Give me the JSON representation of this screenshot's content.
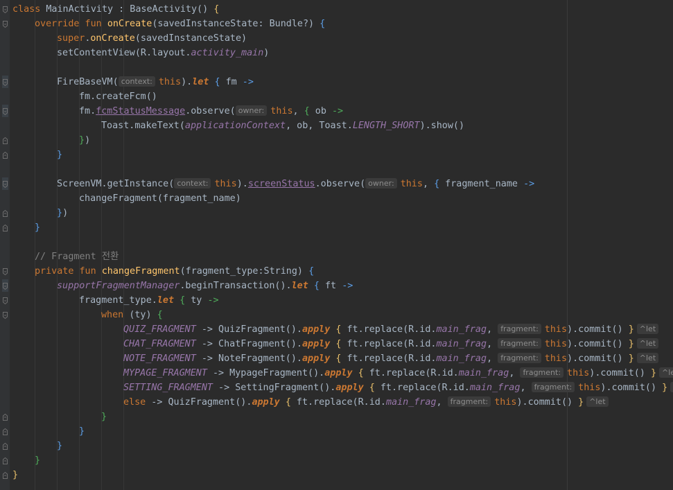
{
  "editor": {
    "language": "Kotlin",
    "lines": [
      [
        [
          "kw",
          "class "
        ],
        [
          "t",
          "MainActivity : BaseActivity() "
        ],
        [
          "by",
          "{"
        ]
      ],
      [
        [
          "kw",
          "override fun "
        ],
        [
          "fn",
          "onCreate"
        ],
        [
          "t",
          "(savedInstanceState: Bundle?) "
        ],
        [
          "bb",
          "{"
        ]
      ],
      [
        [
          "kw",
          "super"
        ],
        [
          "t",
          "."
        ],
        [
          "fn",
          "onCreate"
        ],
        [
          "t",
          "(savedInstanceState)"
        ]
      ],
      [
        [
          "t",
          "setContentView(R.layout."
        ],
        [
          "prop",
          "activity_main"
        ],
        [
          "t",
          ")"
        ]
      ],
      [],
      [
        [
          "t",
          "FireBaseVM("
        ],
        [
          "hint",
          "context:"
        ],
        [
          "this",
          "this"
        ],
        [
          "t",
          ")."
        ],
        [
          "lkw",
          "let"
        ],
        [
          "t",
          " "
        ],
        [
          "bb",
          "{"
        ],
        [
          "t",
          " fm "
        ],
        [
          "bb",
          "->"
        ]
      ],
      [
        [
          "t",
          "fm.createFcm()"
        ]
      ],
      [
        [
          "t",
          "fm."
        ],
        [
          "link",
          "fcmStatusMessage"
        ],
        [
          "t",
          ".observe("
        ],
        [
          "hint",
          "owner:"
        ],
        [
          "this",
          "this"
        ],
        [
          "t",
          ", "
        ],
        [
          "bg",
          "{"
        ],
        [
          "t",
          " ob "
        ],
        [
          "bg",
          "->"
        ]
      ],
      [
        [
          "t",
          "Toast.makeText("
        ],
        [
          "prop",
          "applicationContext"
        ],
        [
          "t",
          ", ob, Toast."
        ],
        [
          "prop",
          "LENGTH_SHORT"
        ],
        [
          "t",
          ").show()"
        ]
      ],
      [
        [
          "bg",
          "}"
        ],
        [
          "t",
          ")"
        ]
      ],
      [
        [
          "bb",
          "}"
        ]
      ],
      [],
      [
        [
          "t",
          "ScreenVM.getInstance("
        ],
        [
          "hint",
          "context:"
        ],
        [
          "this",
          "this"
        ],
        [
          "t",
          ")."
        ],
        [
          "link",
          "screenStatus"
        ],
        [
          "t",
          ".observe("
        ],
        [
          "hint",
          "owner:"
        ],
        [
          "this",
          "this"
        ],
        [
          "t",
          ", "
        ],
        [
          "bb",
          "{"
        ],
        [
          "t",
          " fragment_name "
        ],
        [
          "bb",
          "->"
        ]
      ],
      [
        [
          "t",
          "changeFragment(fragment_name)"
        ]
      ],
      [
        [
          "bb",
          "}"
        ],
        [
          "t",
          ")"
        ]
      ],
      [
        [
          "bb",
          "}"
        ]
      ],
      [],
      [
        [
          "c",
          "// Fragment 전환"
        ]
      ],
      [
        [
          "kw",
          "private fun "
        ],
        [
          "fn",
          "changeFragment"
        ],
        [
          "t",
          "(fragment_type:String) "
        ],
        [
          "bb",
          "{"
        ]
      ],
      [
        [
          "prop",
          "supportFragmentManager"
        ],
        [
          "t",
          ".beginTransaction()."
        ],
        [
          "lkw",
          "let"
        ],
        [
          "t",
          " "
        ],
        [
          "bb",
          "{"
        ],
        [
          "t",
          " ft "
        ],
        [
          "bb",
          "->"
        ]
      ],
      [
        [
          "t",
          "fragment_type."
        ],
        [
          "lkw",
          "let"
        ],
        [
          "t",
          " "
        ],
        [
          "bg",
          "{"
        ],
        [
          "t",
          " ty "
        ],
        [
          "bg",
          "->"
        ]
      ],
      [
        [
          "kw",
          "when "
        ],
        [
          "t",
          "(ty) "
        ],
        [
          "bg",
          "{"
        ]
      ],
      [
        [
          "prop",
          "QUIZ_FRAGMENT"
        ],
        [
          "t",
          " -> QuizFragment()."
        ],
        [
          "lkw",
          "apply"
        ],
        [
          "t",
          " "
        ],
        [
          "by",
          "{"
        ],
        [
          "t",
          " ft.replace(R.id."
        ],
        [
          "prop",
          "main_frag"
        ],
        [
          "t",
          ", "
        ],
        [
          "hint",
          "fragment:"
        ],
        [
          "this",
          "this"
        ],
        [
          "t",
          ").commit() "
        ],
        [
          "by",
          "}"
        ],
        [
          "hintlet",
          "^let"
        ]
      ],
      [
        [
          "prop",
          "CHAT_FRAGMENT"
        ],
        [
          "t",
          " -> ChatFragment()."
        ],
        [
          "lkw",
          "apply"
        ],
        [
          "t",
          " "
        ],
        [
          "by",
          "{"
        ],
        [
          "t",
          " ft.replace(R.id."
        ],
        [
          "prop",
          "main_frag"
        ],
        [
          "t",
          ", "
        ],
        [
          "hint",
          "fragment:"
        ],
        [
          "this",
          "this"
        ],
        [
          "t",
          ").commit() "
        ],
        [
          "by",
          "}"
        ],
        [
          "hintlet",
          "^let"
        ]
      ],
      [
        [
          "prop",
          "NOTE_FRAGMENT"
        ],
        [
          "t",
          " -> NoteFragment()."
        ],
        [
          "lkw",
          "apply"
        ],
        [
          "t",
          " "
        ],
        [
          "by",
          "{"
        ],
        [
          "t",
          " ft.replace(R.id."
        ],
        [
          "prop",
          "main_frag"
        ],
        [
          "t",
          ", "
        ],
        [
          "hint",
          "fragment:"
        ],
        [
          "this",
          "this"
        ],
        [
          "t",
          ").commit() "
        ],
        [
          "by",
          "}"
        ],
        [
          "hintlet",
          "^let"
        ]
      ],
      [
        [
          "prop",
          "MYPAGE_FRAGMENT"
        ],
        [
          "t",
          " -> MypageFragment()."
        ],
        [
          "lkw",
          "apply"
        ],
        [
          "t",
          " "
        ],
        [
          "by",
          "{"
        ],
        [
          "t",
          " ft.replace(R.id."
        ],
        [
          "prop",
          "main_frag"
        ],
        [
          "t",
          ", "
        ],
        [
          "hint",
          "fragment:"
        ],
        [
          "this",
          "this"
        ],
        [
          "t",
          ").commit() "
        ],
        [
          "by",
          "}"
        ],
        [
          "hintlet",
          "^let"
        ]
      ],
      [
        [
          "prop",
          "SETTING_FRAGMENT"
        ],
        [
          "t",
          " -> SettingFragment()."
        ],
        [
          "lkw",
          "apply"
        ],
        [
          "t",
          " "
        ],
        [
          "by",
          "{"
        ],
        [
          "t",
          " ft.replace(R.id."
        ],
        [
          "prop",
          "main_frag"
        ],
        [
          "t",
          ", "
        ],
        [
          "hint",
          "fragment:"
        ],
        [
          "this",
          "this"
        ],
        [
          "t",
          ").commit() "
        ],
        [
          "by",
          "}"
        ],
        [
          "hintlet",
          "^let"
        ]
      ],
      [
        [
          "kw",
          "else"
        ],
        [
          "t",
          " -> QuizFragment()."
        ],
        [
          "lkw",
          "apply"
        ],
        [
          "t",
          " "
        ],
        [
          "by",
          "{"
        ],
        [
          "t",
          " ft.replace(R.id."
        ],
        [
          "prop",
          "main_frag"
        ],
        [
          "t",
          ", "
        ],
        [
          "hint",
          "fragment:"
        ],
        [
          "this",
          "this"
        ],
        [
          "t",
          ").commit() "
        ],
        [
          "by",
          "}"
        ],
        [
          "hintlet",
          "^let"
        ]
      ],
      [
        [
          "bg",
          "}"
        ]
      ],
      [
        [
          "bb",
          "}"
        ]
      ],
      [
        [
          "bb",
          "}"
        ]
      ],
      [
        [
          "bg",
          "}"
        ]
      ],
      [
        [
          "by",
          "}"
        ]
      ]
    ]
  },
  "colors": {
    "background": "#2b2b2b",
    "gutter": "#313335",
    "keyword": "#cc7832",
    "function": "#ffc66d",
    "property": "#9876aa",
    "text": "#a9b7c6",
    "comment": "#808080"
  }
}
